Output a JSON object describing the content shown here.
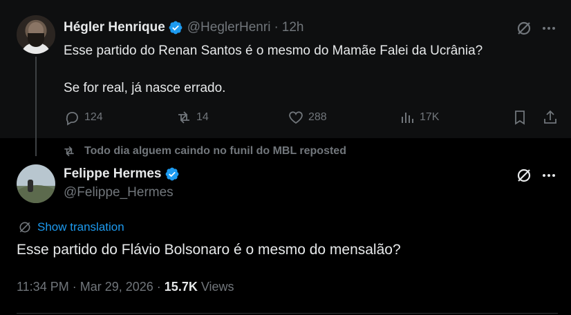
{
  "tweet1": {
    "author_name": "Hégler Henrique",
    "handle": "@HeglerHenri",
    "separator": "·",
    "time": "12h",
    "text_line1": "Esse partido do Renan Santos é o mesmo do Mamãe Falei da Ucrânia?",
    "text_line2": "Se for real, já nasce errado.",
    "replies": "124",
    "reposts": "14",
    "likes": "288",
    "views": "17K"
  },
  "repost_banner": {
    "text": "Todo dia alguem caindo no funil do MBL reposted"
  },
  "tweet2": {
    "author_name": "Felippe Hermes",
    "handle": "@Felippe_Hermes",
    "show_translation": "Show translation",
    "text": "Esse partido do Flávio Bolsonaro é o mesmo do mensalão?",
    "time": "11:34 PM",
    "separator": "·",
    "date": "Mar 29, 2026",
    "view_count": "15.7K",
    "views_label": "Views"
  },
  "colors": {
    "accent": "#1d9bf0",
    "muted": "#71767b",
    "text": "#e7e9ea",
    "background": "#000000"
  },
  "icons": [
    "grok-icon",
    "more-icon",
    "reply-icon",
    "repost-icon",
    "like-icon",
    "views-icon",
    "bookmark-icon",
    "share-icon",
    "verified-icon",
    "translate-icon"
  ]
}
